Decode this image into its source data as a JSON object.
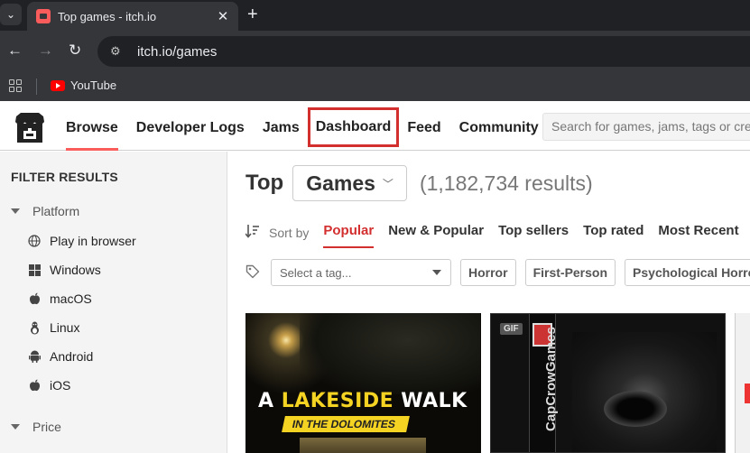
{
  "browser": {
    "tab_title": "Top games - itch.io",
    "tab_close": "✕",
    "new_tab": "+",
    "url": "itch.io/games",
    "bookmarks": [
      {
        "label": "YouTube",
        "icon": "youtube-icon"
      }
    ]
  },
  "site": {
    "nav": [
      {
        "label": "Browse",
        "active": true
      },
      {
        "label": "Developer Logs"
      },
      {
        "label": "Jams"
      },
      {
        "label": "Dashboard",
        "highlighted": true
      },
      {
        "label": "Feed"
      },
      {
        "label": "Community"
      }
    ],
    "search_placeholder": "Search for games, jams, tags or creators",
    "accent_color": "#fa5c5c"
  },
  "sidebar": {
    "title": "FILTER RESULTS",
    "platform_label": "Platform",
    "platforms": [
      {
        "label": "Play in browser",
        "icon": "globe-icon"
      },
      {
        "label": "Windows",
        "icon": "windows-icon"
      },
      {
        "label": "macOS",
        "icon": "apple-icon"
      },
      {
        "label": "Linux",
        "icon": "linux-icon"
      },
      {
        "label": "Android",
        "icon": "android-icon"
      },
      {
        "label": "iOS",
        "icon": "apple-icon"
      }
    ],
    "price_label": "Price"
  },
  "main": {
    "heading_prefix": "Top",
    "heading_category": "Games",
    "results_count": "(1,182,734 results)",
    "sort_label": "Sort by",
    "sort_options": [
      {
        "label": "Popular",
        "active": true
      },
      {
        "label": "New & Popular"
      },
      {
        "label": "Top sellers"
      },
      {
        "label": "Top rated"
      },
      {
        "label": "Most Recent"
      }
    ],
    "tag_select_placeholder": "Select a tag...",
    "tag_pills": [
      "Horror",
      "First-Person",
      "Psychological Horror"
    ],
    "games": [
      {
        "title_prefix": "A ",
        "title_highlight": "LAKESIDE",
        "title_suffix": " WALK",
        "subtitle": "IN THE DOLOMITES"
      },
      {
        "badge": "GIF",
        "spine_text": "CapCrowGames"
      }
    ]
  }
}
